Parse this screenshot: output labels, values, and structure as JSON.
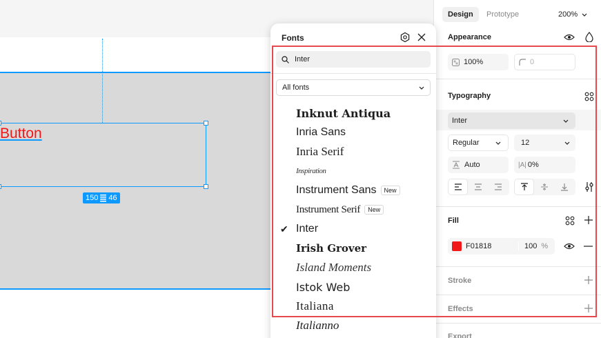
{
  "canvas": {
    "button_text": "Button",
    "dims": {
      "width": "150",
      "height": "46"
    }
  },
  "fonts_popup": {
    "title": "Fonts",
    "search_value": "Inter",
    "filter_label": "All fonts",
    "new_badge": "New",
    "items": [
      {
        "label": "Inknut Antiqua",
        "selected": false,
        "new": false
      },
      {
        "label": "Inria Sans",
        "selected": false,
        "new": false
      },
      {
        "label": "Inria Serif",
        "selected": false,
        "new": false
      },
      {
        "label": "Inspiration",
        "selected": false,
        "new": false
      },
      {
        "label": "Instrument Sans",
        "selected": false,
        "new": true
      },
      {
        "label": "Instrument Serif",
        "selected": false,
        "new": true
      },
      {
        "label": "Inter",
        "selected": true,
        "new": false
      },
      {
        "label": "Irish Grover",
        "selected": false,
        "new": false
      },
      {
        "label": "Island Moments",
        "selected": false,
        "new": false
      },
      {
        "label": "Istok Web",
        "selected": false,
        "new": false
      },
      {
        "label": "Italiana",
        "selected": false,
        "new": false
      },
      {
        "label": "Italianno",
        "selected": false,
        "new": false
      }
    ]
  },
  "right_panel": {
    "tabs": {
      "design": "Design",
      "prototype": "Prototype"
    },
    "zoom": "200%",
    "appearance": {
      "title": "Appearance",
      "opacity": "100%",
      "radius": "0"
    },
    "typography": {
      "title": "Typography",
      "font_family": "Inter",
      "font_weight": "Regular",
      "font_size": "12",
      "line_height": "Auto",
      "letter_spacing": "0%",
      "letter_spacing_icon": "|A|"
    },
    "fill": {
      "title": "Fill",
      "color_hex": "F01818",
      "color": "#f01818",
      "opacity": "100",
      "opacity_unit": "%"
    },
    "stroke": {
      "title": "Stroke"
    },
    "effects": {
      "title": "Effects"
    },
    "export": {
      "title": "Export"
    }
  },
  "colors": {
    "selection": "#0d99ff",
    "highlight": "#e5484d",
    "canvas_frame": "#d9d9d9"
  }
}
